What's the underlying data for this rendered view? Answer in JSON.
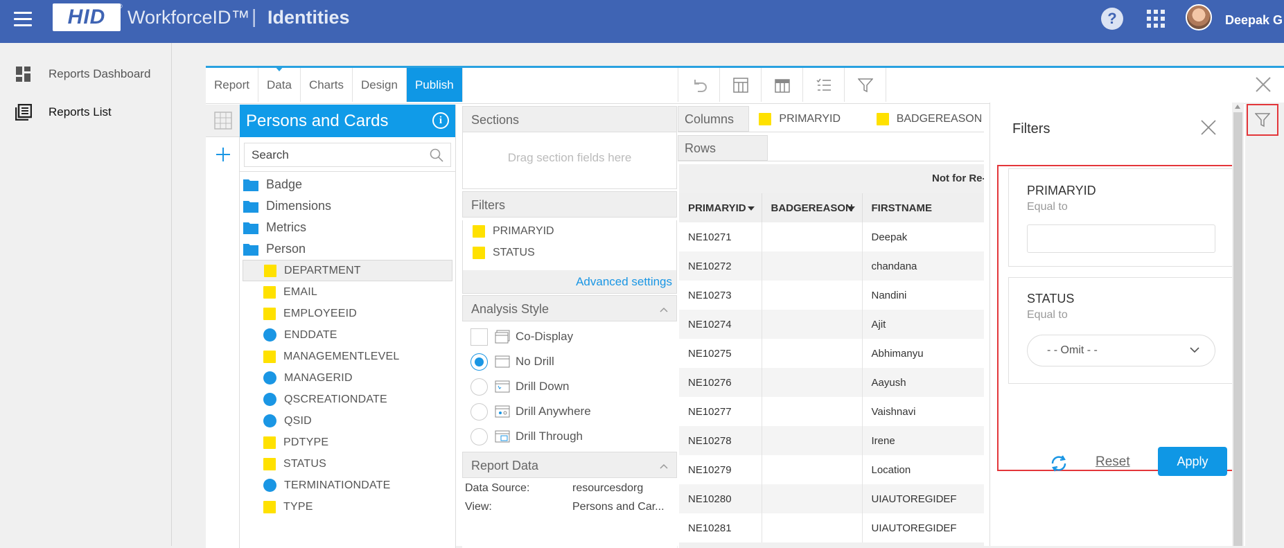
{
  "header": {
    "logo_text": "HID",
    "logo_tm": "®",
    "app_name": "WorkforceID™",
    "separator": "|",
    "section": "Identities",
    "help_glyph": "?",
    "user_name": "Deepak G"
  },
  "sidebar": {
    "items": [
      {
        "label": "Reports Dashboard",
        "icon": "dashboard-icon"
      },
      {
        "label": "Reports List",
        "icon": "list-icon"
      }
    ]
  },
  "tabs": [
    {
      "label": "Report"
    },
    {
      "label": "Data"
    },
    {
      "label": "Charts"
    },
    {
      "label": "Design"
    },
    {
      "label": "Publish"
    }
  ],
  "fields_panel": {
    "title": "Persons and Cards",
    "search_placeholder": "Search",
    "folders": [
      "Badge",
      "Dimensions",
      "Metrics",
      "Person"
    ],
    "fields": [
      {
        "label": "DEPARTMENT",
        "kind": "dimension"
      },
      {
        "label": "EMAIL",
        "kind": "dimension"
      },
      {
        "label": "EMPLOYEEID",
        "kind": "dimension"
      },
      {
        "label": "ENDDATE",
        "kind": "metric"
      },
      {
        "label": "MANAGEMENTLEVEL",
        "kind": "dimension"
      },
      {
        "label": "MANAGERID",
        "kind": "metric"
      },
      {
        "label": "QSCREATIONDATE",
        "kind": "metric"
      },
      {
        "label": "QSID",
        "kind": "metric"
      },
      {
        "label": "PDTYPE",
        "kind": "dimension"
      },
      {
        "label": "STATUS",
        "kind": "dimension"
      },
      {
        "label": "TERMINATIONDATE",
        "kind": "metric"
      },
      {
        "label": "TYPE",
        "kind": "dimension"
      }
    ]
  },
  "sections": {
    "title": "Sections",
    "placeholder": "Drag section fields here"
  },
  "filters_panel": {
    "title": "Filters",
    "items": [
      "PRIMARYID",
      "STATUS"
    ],
    "advanced": "Advanced settings"
  },
  "analysis_style": {
    "title": "Analysis Style",
    "options": [
      {
        "label": "Co-Display",
        "type": "checkbox"
      },
      {
        "label": "No Drill",
        "type": "radio",
        "checked": true
      },
      {
        "label": "Drill Down",
        "type": "radio"
      },
      {
        "label": "Drill Anywhere",
        "type": "radio"
      },
      {
        "label": "Drill Through",
        "type": "radio"
      }
    ]
  },
  "report_data": {
    "title": "Report Data",
    "rows": [
      {
        "key": "Data Source:",
        "value": "resourcesdorg"
      },
      {
        "key": "View:",
        "value": "Persons and Car..."
      }
    ]
  },
  "columns_row": {
    "label": "Columns",
    "chips": [
      "PRIMARYID",
      "BADGEREASON"
    ]
  },
  "rows_row": {
    "label": "Rows"
  },
  "table": {
    "title": "Not for Re-Sale",
    "headers": [
      "PRIMARYID",
      "BADGEREASON",
      "FIRSTNAME"
    ],
    "rows": [
      [
        "NE10271",
        "",
        "Deepak"
      ],
      [
        "NE10272",
        "",
        "chandana"
      ],
      [
        "NE10273",
        "",
        "Nandini"
      ],
      [
        "NE10274",
        "",
        "Ajit"
      ],
      [
        "NE10275",
        "",
        "Abhimanyu"
      ],
      [
        "NE10276",
        "",
        "Aayush"
      ],
      [
        "NE10277",
        "",
        "Vaishnavi"
      ],
      [
        "NE10278",
        "",
        "Irene"
      ],
      [
        "NE10279",
        "",
        "Location"
      ],
      [
        "NE10280",
        "",
        "UIAUTOREGIDEF"
      ],
      [
        "NE10281",
        "",
        "UIAUTOREGIDEF"
      ]
    ]
  },
  "filter_flyout": {
    "title": "Filters",
    "filters": [
      {
        "name": "PRIMARYID",
        "operator": "Equal to",
        "value": ""
      },
      {
        "name": "STATUS",
        "operator": "Equal to",
        "selected": "- - Omit - -"
      }
    ],
    "reset": "Reset",
    "apply": "Apply"
  },
  "colors": {
    "header_bg": "#3f64b4",
    "accent": "#0f97e5",
    "highlight_red": "#e3363a",
    "dimension_yellow": "#ffe100"
  }
}
